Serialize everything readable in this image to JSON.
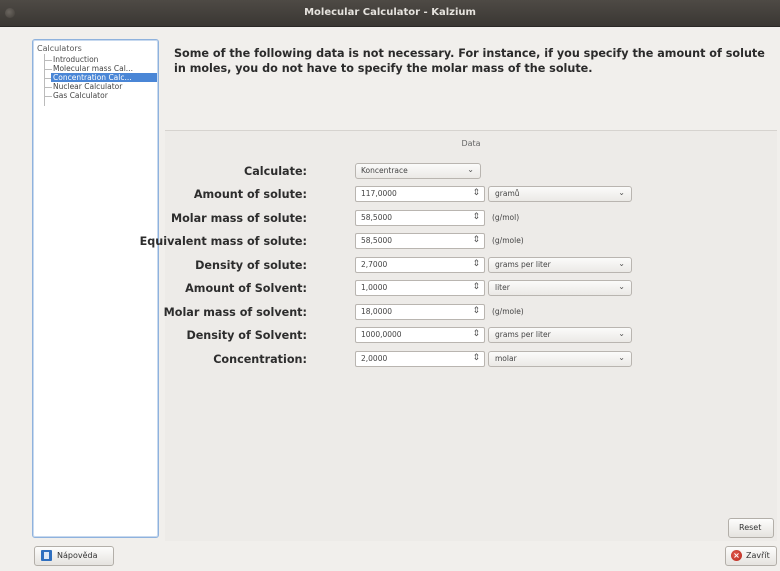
{
  "window": {
    "title": "Molecular Calculator - Kalzium"
  },
  "sidebar": {
    "root": "Calculators",
    "items": [
      {
        "label": "Introduction"
      },
      {
        "label": "Molecular mass Cal..."
      },
      {
        "label": "Concentration Calc...",
        "selected": true
      },
      {
        "label": "Nuclear Calculator"
      },
      {
        "label": "Gas Calculator"
      }
    ]
  },
  "description": "Some of the following data is not necessary.  For instance, if you specify the amount of solute in moles, you do not have to specify the molar mass of the solute.",
  "data_group": {
    "label": "Data"
  },
  "calculate": {
    "label": "Calculate:",
    "value": "Koncentrace"
  },
  "fields": [
    {
      "label": "Amount of solute:",
      "value": "117,0000",
      "unit": "gramů",
      "unit_is_combo": true
    },
    {
      "label": "Molar mass of solute:",
      "value": "58,5000",
      "unit": "(g/mol)",
      "unit_is_combo": false
    },
    {
      "label": "Equivalent mass of solute:",
      "value": "58,5000",
      "unit": "(g/mole)",
      "unit_is_combo": false
    },
    {
      "label": "Density of solute:",
      "value": "2,7000",
      "unit": "grams per liter",
      "unit_is_combo": true
    },
    {
      "label": "Amount of Solvent:",
      "value": "1,0000",
      "unit": "liter",
      "unit_is_combo": true
    },
    {
      "label": "Molar mass of solvent:",
      "value": "18,0000",
      "unit": "(g/mole)",
      "unit_is_combo": false
    },
    {
      "label": "Density of Solvent:",
      "value": "1000,0000",
      "unit": "grams per liter",
      "unit_is_combo": true
    },
    {
      "label": "Concentration:",
      "value": "2,0000",
      "unit": "molar",
      "unit_is_combo": true
    }
  ],
  "buttons": {
    "reset": "Reset",
    "help": "Nápověda",
    "close": "Zavřít"
  },
  "icons": {
    "spin": "updown-arrows-icon",
    "dropdown": "chevron-down-icon"
  }
}
